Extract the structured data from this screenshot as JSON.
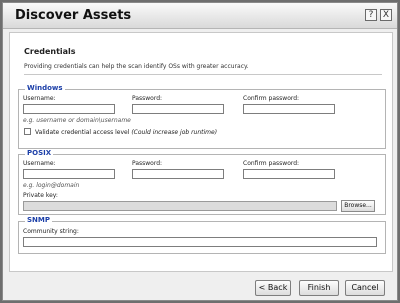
{
  "dialog": {
    "title": "Discover Assets",
    "help_label": "?",
    "close_label": "X"
  },
  "credentials": {
    "title": "Credentials",
    "description": "Providing credentials can help the scan identify OSs with greater accuracy."
  },
  "windows": {
    "legend": "Windows",
    "username_label": "Username:",
    "password_label": "Password:",
    "confirm_label": "Confirm password:",
    "username_hint": "e.g. username or domain\\username",
    "validate_label": "Validate credential access level",
    "validate_note": "(Could increase job runtime)"
  },
  "posix": {
    "legend": "POSIX",
    "username_label": "Username:",
    "password_label": "Password:",
    "confirm_label": "Confirm password:",
    "username_hint": "e.g. login@domain",
    "private_key_label": "Private key:",
    "browse_label": "Browse..."
  },
  "snmp": {
    "legend": "SNMP",
    "community_label": "Community string:"
  },
  "footer": {
    "back_label": "< Back",
    "finish_label": "Finish",
    "cancel_label": "Cancel"
  }
}
